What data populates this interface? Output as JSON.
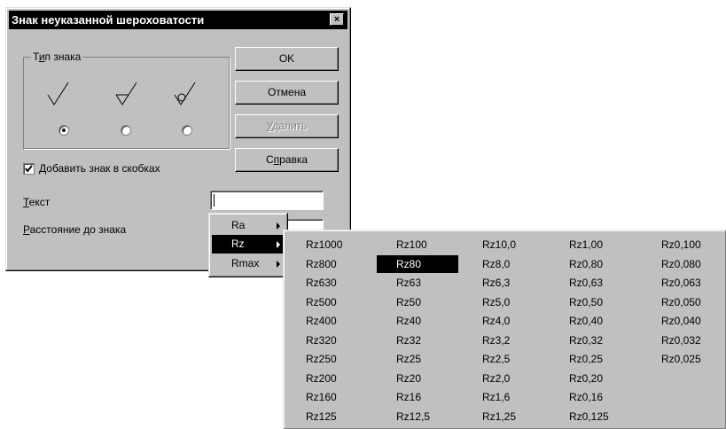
{
  "dialog": {
    "title": "Знак неуказанной шероховатости",
    "close_label": "×",
    "group_label_pre": "Т",
    "group_label_u": "и",
    "group_label_post": "п знака",
    "buttons": {
      "ok": "OK",
      "cancel": "Отмена",
      "delete_u": "У",
      "delete_rest": "далить",
      "help_pre": "С",
      "help_u": "п",
      "help_post": "равка"
    },
    "checkbox_u": "Д",
    "checkbox_rest": "обавить знак в скобках",
    "checkbox_checked": true,
    "text_label_u": "Т",
    "text_label_rest": "екст",
    "text_value": "",
    "distance_label_u": "Р",
    "distance_label_rest": "асстояние до знака",
    "selected_sign_index": 0
  },
  "menu": {
    "items": [
      "Ra",
      "Rz",
      "Rmax"
    ],
    "selected": "Rz"
  },
  "submenu": {
    "columns": [
      [
        "Rz1000",
        "Rz800",
        "Rz630",
        "Rz500",
        "Rz400",
        "Rz320",
        "Rz250",
        "Rz200",
        "Rz160",
        "Rz125"
      ],
      [
        "Rz100",
        "Rz80",
        "Rz63",
        "Rz50",
        "Rz40",
        "Rz32",
        "Rz25",
        "Rz20",
        "Rz16",
        "Rz12,5"
      ],
      [
        "Rz10,0",
        "Rz8,0",
        "Rz6,3",
        "Rz5,0",
        "Rz4,0",
        "Rz3,2",
        "Rz2,5",
        "Rz2,0",
        "Rz1,6",
        "Rz1,25"
      ],
      [
        "Rz1,00",
        "Rz0,80",
        "Rz0,63",
        "Rz0,50",
        "Rz0,40",
        "Rz0,32",
        "Rz0,25",
        "Rz0,20",
        "Rz0,16",
        "Rz0,125"
      ],
      [
        "Rz0,100",
        "Rz0,080",
        "Rz0,063",
        "Rz0,050",
        "Rz0,040",
        "Rz0,032",
        "Rz0,025"
      ]
    ],
    "selected": "Rz80"
  }
}
